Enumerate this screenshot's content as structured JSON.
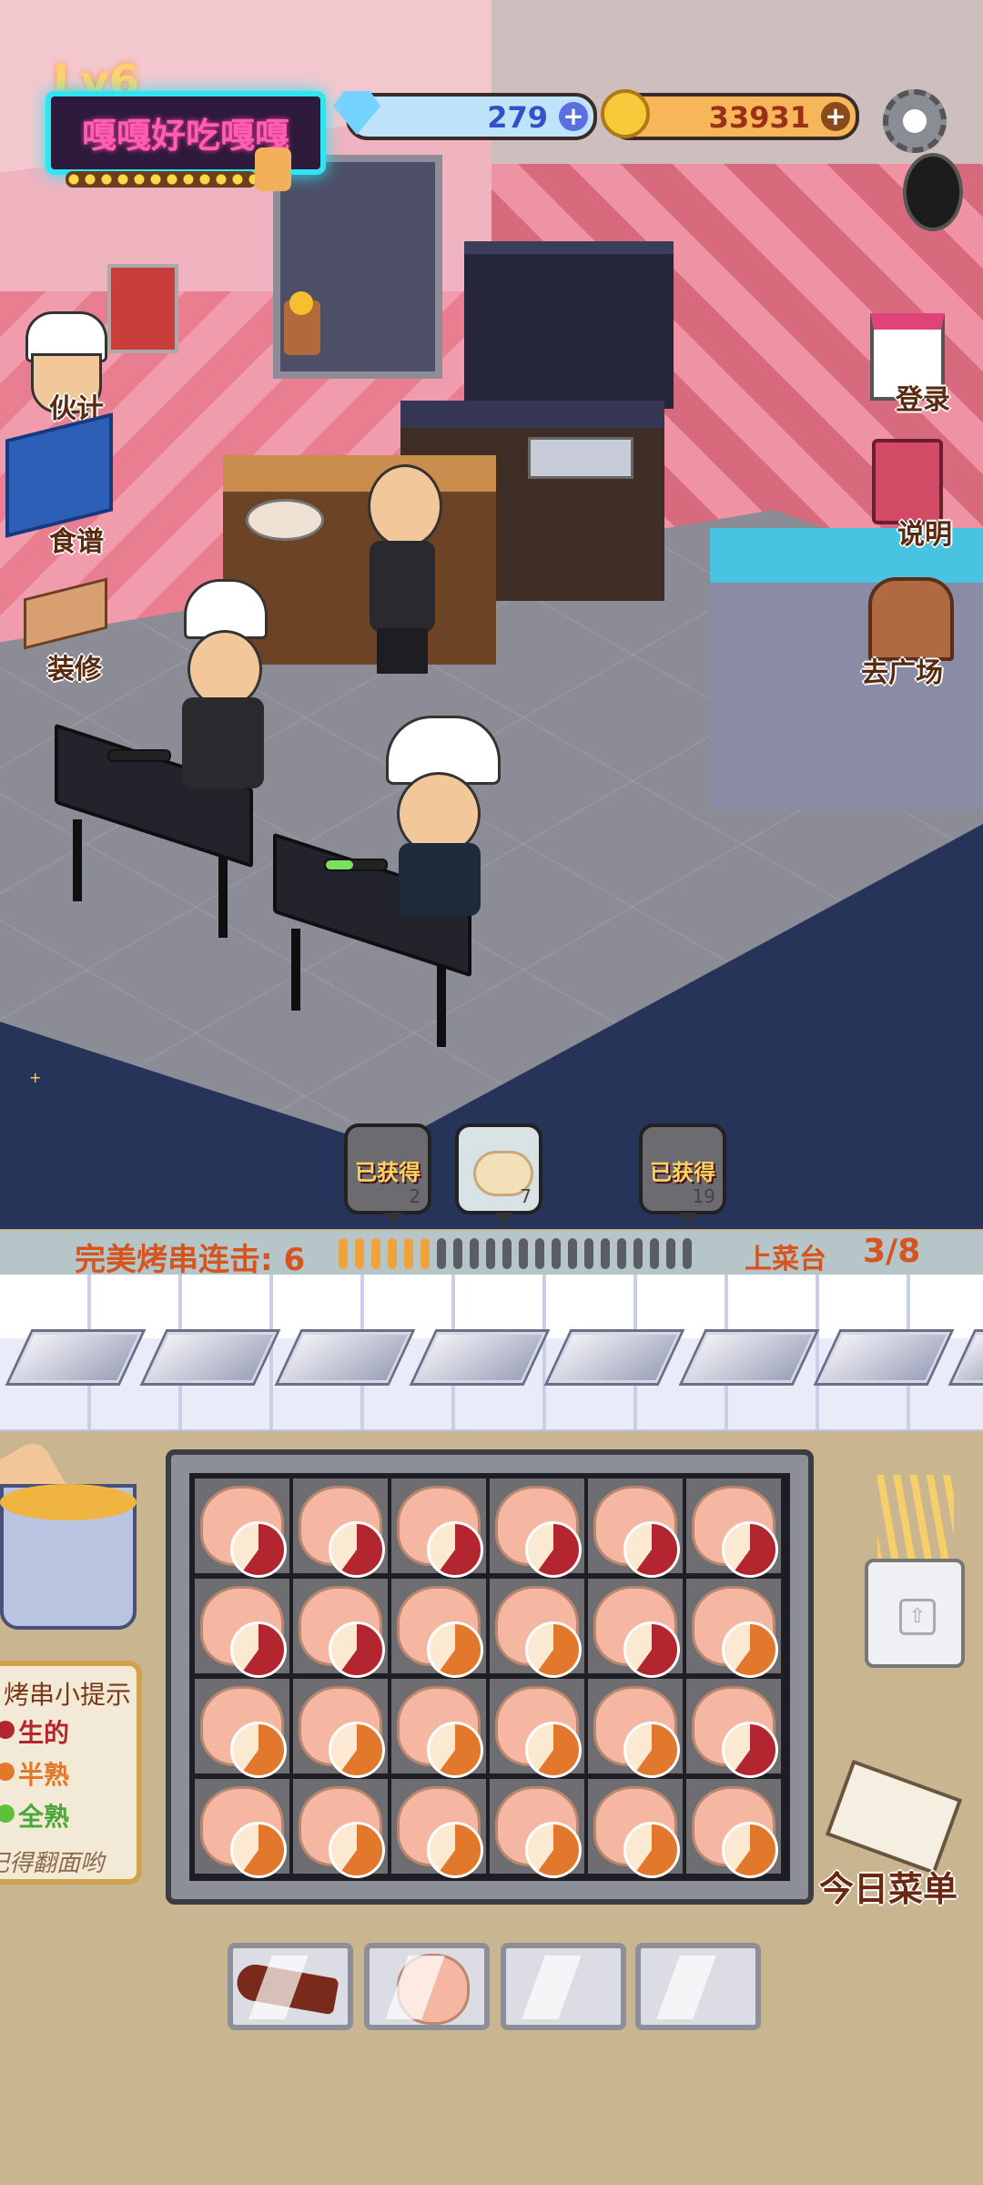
{
  "hud": {
    "level": "Lv6",
    "restaurant_name": "嘎嘎好吃嘎嘎",
    "gems": "279",
    "coins": "33931",
    "plus": "+"
  },
  "left_menu": [
    {
      "label": "伙计",
      "icon": "chef-hat-icon"
    },
    {
      "label": "食谱",
      "icon": "recipe-book-icon"
    },
    {
      "label": "装修",
      "icon": "table-decor-icon"
    }
  ],
  "right_menu": [
    {
      "label": "登录",
      "icon": "calendar-icon"
    },
    {
      "label": "说明",
      "icon": "manual-book-icon"
    },
    {
      "label": "去广场",
      "icon": "door-icon"
    }
  ],
  "collected_items": [
    {
      "text": "已获得",
      "count": "2"
    },
    {
      "text": "",
      "count": "7"
    },
    {
      "text": "已获得",
      "count": "19"
    }
  ],
  "combo": {
    "label": "完美烤串连击:",
    "value": "6",
    "segments_filled": 6,
    "segments_total": 22
  },
  "serving_counter": {
    "label": "上菜台",
    "value": "3/8"
  },
  "tips": {
    "title": "烤串小提示",
    "raw": "生的",
    "medium": "半熟",
    "done": "全熟",
    "footer": "记得翻面哟"
  },
  "todays_menu": "今日菜单",
  "colors": {
    "raw": "#b3262f",
    "medium": "#e2782c",
    "done": "#5fbf3f",
    "neon_border": "#2ee5f3",
    "neon_text": "#ff5fb3"
  },
  "grill_grid": [
    [
      "raw",
      "raw",
      "raw",
      "raw",
      "raw",
      "raw"
    ],
    [
      "raw",
      "raw",
      "medium",
      "medium",
      "raw",
      "medium"
    ],
    [
      "medium",
      "medium",
      "medium",
      "medium",
      "medium",
      "raw"
    ],
    [
      "medium",
      "medium",
      "medium",
      "medium",
      "medium",
      "medium"
    ]
  ],
  "dish_slots": [
    {
      "item": "lamb-leg-skewer-icon"
    },
    {
      "item": "scallop-icon"
    },
    {
      "item": "empty"
    },
    {
      "item": "empty"
    }
  ]
}
